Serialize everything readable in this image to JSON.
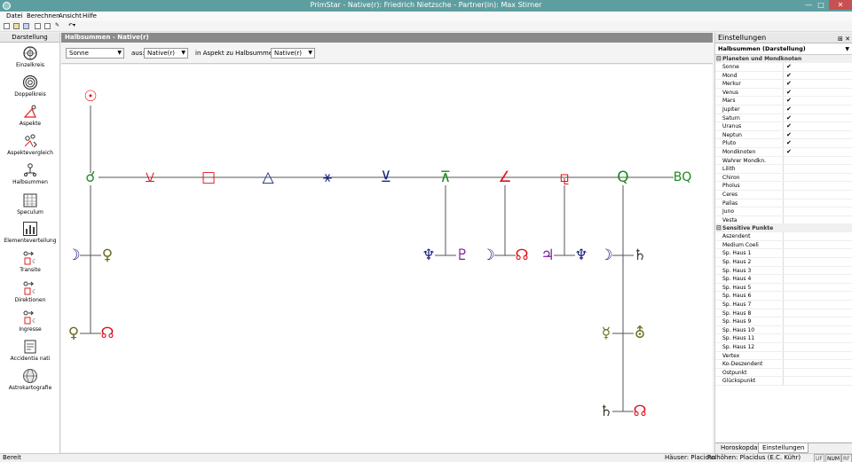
{
  "window": {
    "title": "PrimStar - Native(r): Friedrich Nietzsche - Partner(in): Max Stirner"
  },
  "menu": [
    "Datei",
    "Berechnen",
    "Ansicht",
    "Hilfe"
  ],
  "left_panel": {
    "header": "Darstellung",
    "items": [
      {
        "label": "Einzelkreis",
        "icon": "single-circle-icon"
      },
      {
        "label": "Doppelkreis",
        "icon": "double-circle-icon"
      },
      {
        "label": "Aspekte",
        "icon": "aspects-icon"
      },
      {
        "label": "Aspektevergleich",
        "icon": "aspect-compare-icon"
      },
      {
        "label": "Halbsummen",
        "icon": "midpoints-icon"
      },
      {
        "label": "Speculum",
        "icon": "speculum-icon"
      },
      {
        "label": "Elementeverteilung",
        "icon": "bar-chart-icon"
      },
      {
        "label": "Transite",
        "icon": "transits-icon"
      },
      {
        "label": "Direktionen",
        "icon": "directions-icon"
      },
      {
        "label": "Ingresse",
        "icon": "ingresses-icon"
      },
      {
        "label": "Accidentia nati",
        "icon": "accidentia-icon"
      },
      {
        "label": "Astrokartografie",
        "icon": "globe-icon"
      }
    ]
  },
  "document": {
    "header": "Halbsummen - Native(r)",
    "filter": {
      "planet": "Sonne",
      "from_label": "aus:",
      "from_value": "Native(r)",
      "aspect_label": "in Aspekt zu Halbsummen aus:",
      "aspect_value": "Native(r)"
    }
  },
  "diagram": {
    "root": {
      "glyph": "☉",
      "color": "#e0101a"
    },
    "aspect_row": [
      {
        "glyph": "☌",
        "color": "#2e8b2e"
      },
      {
        "glyph": "⚺",
        "color": "#e0101a"
      },
      {
        "glyph": "□",
        "color": "#e0101a"
      },
      {
        "glyph": "△",
        "color": "#1a237e"
      },
      {
        "glyph": "⚹",
        "color": "#1a237e"
      },
      {
        "glyph": "⊻",
        "color": "#1a237e"
      },
      {
        "glyph": "⊼",
        "color": "#1a8a1a"
      },
      {
        "glyph": "∠",
        "color": "#e0101a"
      },
      {
        "glyph": "⚼",
        "color": "#e0101a"
      },
      {
        "glyph": "Q",
        "color": "#1a8a1a"
      },
      {
        "glyph": "BQ",
        "color": "#1a8a1a"
      }
    ],
    "pairs": [
      {
        "left": {
          "glyph": "☽",
          "color": "#1a237e"
        },
        "right": {
          "glyph": "♀",
          "color": "#6b6b1f"
        }
      },
      {
        "left": {
          "glyph": "♀",
          "color": "#6b6b1f"
        },
        "right": {
          "glyph": "☊",
          "color": "#e0101a"
        }
      },
      {
        "left": {
          "glyph": "♆",
          "color": "#1a237e"
        },
        "right": {
          "glyph": "♇",
          "color": "#7b1f9e"
        }
      },
      {
        "left": {
          "glyph": "☽",
          "color": "#1a237e"
        },
        "right": {
          "glyph": "☊",
          "color": "#e0101a"
        }
      },
      {
        "left": {
          "glyph": "♃",
          "color": "#7b1f9e"
        },
        "right": {
          "glyph": "♆",
          "color": "#1a237e"
        }
      },
      {
        "left": {
          "glyph": "☽",
          "color": "#1a237e"
        },
        "right": {
          "glyph": "♄",
          "color": "#3d3d2a"
        }
      },
      {
        "left": {
          "glyph": "☿",
          "color": "#6b6b1f"
        },
        "right": {
          "glyph": "⛢",
          "color": "#6b6b1f"
        }
      },
      {
        "left": {
          "glyph": "♄",
          "color": "#3d3d2a"
        },
        "right": {
          "glyph": "☊",
          "color": "#e0101a"
        }
      }
    ]
  },
  "settings": {
    "title": "Einstellungen",
    "pin": "⊞ ✕",
    "subtitle": "Halbsummen (Darstellung)",
    "planets_group": "Planeten und Mondknoten",
    "planets": [
      {
        "name": "Sonne",
        "checked": "✔"
      },
      {
        "name": "Mond",
        "checked": "✔"
      },
      {
        "name": "Merkur",
        "checked": "✔"
      },
      {
        "name": "Venus",
        "checked": "✔"
      },
      {
        "name": "Mars",
        "checked": "✔"
      },
      {
        "name": "Jupiter",
        "checked": "✔"
      },
      {
        "name": "Saturn",
        "checked": "✔"
      },
      {
        "name": "Uranus",
        "checked": "✔"
      },
      {
        "name": "Neptun",
        "checked": "✔"
      },
      {
        "name": "Pluto",
        "checked": "✔"
      },
      {
        "name": "Mondknoten",
        "checked": "✔"
      },
      {
        "name": "Wahrer Mondkn.",
        "checked": ""
      },
      {
        "name": "Lilith",
        "checked": ""
      },
      {
        "name": "Chiron",
        "checked": ""
      },
      {
        "name": "Pholus",
        "checked": ""
      },
      {
        "name": "Ceres",
        "checked": ""
      },
      {
        "name": "Pallas",
        "checked": ""
      },
      {
        "name": "Juno",
        "checked": ""
      },
      {
        "name": "Vesta",
        "checked": ""
      }
    ],
    "sensitive_group": "Sensitive Punkte",
    "sensitive": [
      "Aszendent",
      "Medium Coeli",
      "Sp. Haus 1",
      "Sp. Haus 2",
      "Sp. Haus 3",
      "Sp. Haus 4",
      "Sp. Haus 5",
      "Sp. Haus 6",
      "Sp. Haus 7",
      "Sp. Haus 8",
      "Sp. Haus 9",
      "Sp. Haus 10",
      "Sp. Haus 11",
      "Sp. Haus 12",
      "Vertex",
      "Ko-Deszendent",
      "Ostpunkt",
      "Glückspunkt"
    ],
    "tabs": [
      "Horoskopdaten",
      "Einstellungen"
    ]
  },
  "status": {
    "left": "Bereit",
    "houses": "Häuser: Placidus",
    "poles": "Polhöhen: Placidus (E.C. Kühr)",
    "keys": [
      "UF",
      "NUM",
      "RF"
    ]
  }
}
